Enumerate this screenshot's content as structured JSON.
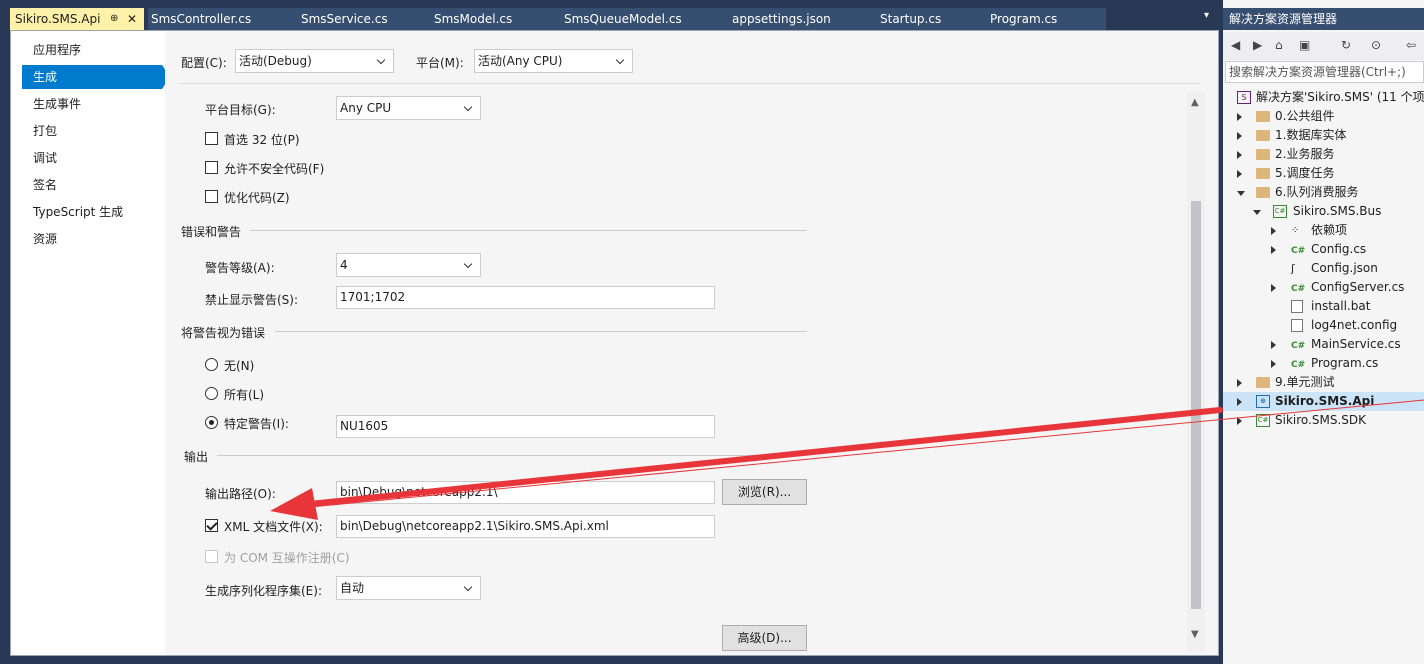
{
  "tabs": [
    {
      "label": "Sikiro.SMS.Api",
      "active": true
    },
    {
      "label": "SmsController.cs"
    },
    {
      "label": "SmsService.cs"
    },
    {
      "label": "SmsModel.cs"
    },
    {
      "label": "SmsQueueModel.cs"
    },
    {
      "label": "appsettings.json"
    },
    {
      "label": "Startup.cs"
    },
    {
      "label": "Program.cs"
    }
  ],
  "tab_glyphs": {
    "pin": "⊕",
    "close": "✕",
    "dropdown": "▾"
  },
  "nav": [
    "应用程序",
    "生成",
    "生成事件",
    "打包",
    "调试",
    "签名",
    "TypeScript 生成",
    "资源"
  ],
  "config": {
    "label": "配置(C):",
    "value": "活动(Debug)"
  },
  "platform": {
    "label": "平台(M):",
    "value": "活动(Any CPU)"
  },
  "platform_target": {
    "label": "平台目标(G):",
    "value": "Any CPU"
  },
  "checks": {
    "prefer32": "首选 32 位(P)",
    "unsafe": "允许不安全代码(F)",
    "optimize": "优化代码(Z)"
  },
  "errors_section": "错误和警告",
  "warning_level": {
    "label": "警告等级(A):",
    "value": "4"
  },
  "suppress": {
    "label": "禁止显示警告(S):",
    "value": "1701;1702"
  },
  "treat_section": "将警告视为错误",
  "radios": {
    "none": "无(N)",
    "all": "所有(L)",
    "specific": "特定警告(I):"
  },
  "specific_value": "NU1605",
  "output_section": "输出",
  "output_path": {
    "label": "输出路径(O):",
    "value": "bin\\Debug\\netcoreapp2.1\\",
    "browse": "浏览(R)..."
  },
  "xml_doc": {
    "label": "XML 文档文件(X):",
    "value": "bin\\Debug\\netcoreapp2.1\\Sikiro.SMS.Api.xml",
    "checked": true
  },
  "com_interop": "为 COM 互操作注册(C)",
  "serialization": {
    "label": "生成序列化程序集(E):",
    "value": "自动"
  },
  "advanced": "高级(D)...",
  "scroll": {
    "up": "▲",
    "down": "▼"
  },
  "solution_explorer": {
    "title": "解决方案资源管理器",
    "search_placeholder": "搜索解决方案资源管理器(Ctrl+;)",
    "toolbar_glyphs": [
      "◀",
      "▶",
      "⌂",
      "▣",
      "↻",
      "⊙",
      "⇦"
    ],
    "items": [
      {
        "text": "解决方案'Sikiro.SMS' (11 个项",
        "icon": "sln"
      },
      {
        "text": "0.公共组件",
        "icon": "folder"
      },
      {
        "text": "1.数据库实体",
        "icon": "folder"
      },
      {
        "text": "2.业务服务",
        "icon": "folder"
      },
      {
        "text": "5.调度任务",
        "icon": "folder"
      },
      {
        "text": "6.队列消费服务",
        "icon": "folder"
      },
      {
        "text": "Sikiro.SMS.Bus",
        "icon": "proj"
      },
      {
        "text": "依赖项",
        "icon": "deps"
      },
      {
        "text": "Config.cs",
        "icon": "cs"
      },
      {
        "text": "Config.json",
        "icon": "json"
      },
      {
        "text": "ConfigServer.cs",
        "icon": "cs"
      },
      {
        "text": "install.bat",
        "icon": "bat"
      },
      {
        "text": "log4net.config",
        "icon": "config"
      },
      {
        "text": "MainService.cs",
        "icon": "cs"
      },
      {
        "text": "Program.cs",
        "icon": "cs"
      },
      {
        "text": "9.单元测试",
        "icon": "folder"
      },
      {
        "text": "Sikiro.SMS.Api",
        "icon": "web",
        "selected": true
      },
      {
        "text": "Sikiro.SMS.SDK",
        "icon": "proj"
      }
    ]
  },
  "colors": {
    "accent": "#007acc",
    "annotation": "#e8353a",
    "tab_active": "#fff1a8"
  }
}
